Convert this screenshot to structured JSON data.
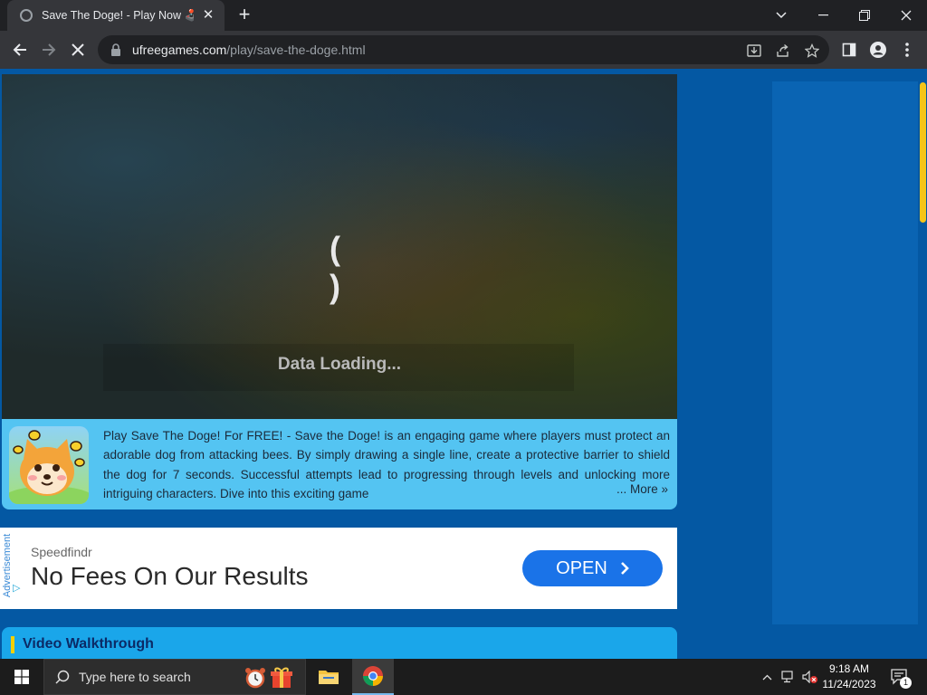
{
  "browser": {
    "tab": {
      "title": "Save The Doge! - Play Now 🕹️ O",
      "close_glyph": "✕"
    },
    "new_tab_glyph": "+",
    "url": {
      "host": "ufreegames.com",
      "path": "/play/save-the-doge.html"
    },
    "icons": {
      "back": "arrow-left-icon",
      "forward": "arrow-right-icon",
      "stop": "close-icon",
      "lock": "lock-icon",
      "install": "install-icon",
      "share": "share-icon",
      "bookmark": "star-icon",
      "side_panel": "side-panel-icon",
      "profile": "profile-icon",
      "menu": "kebab-menu-icon"
    }
  },
  "game": {
    "loading_text": "Data Loading...",
    "spinner": "( )"
  },
  "description": {
    "text": "Play Save The Doge! For FREE! - Save the Doge! is an engaging game where players must protect an adorable dog from attacking bees. By simply drawing a single line, create a protective barrier to shield the dog for 7 seconds. Successful attempts lead to progressing through levels and unlocking more intriguing characters. Dive into this exciting game",
    "more_label": "... More »"
  },
  "ad": {
    "side_label": "Advertisement",
    "source": "Speedfindr",
    "headline": "No Fees On Our Results",
    "cta_label": "OPEN",
    "cta_glyph": "›"
  },
  "sections": {
    "video_walkthrough": "Video Walkthrough"
  },
  "taskbar": {
    "search_placeholder": "Type here to search",
    "time": "9:18 AM",
    "date": "11/24/2023",
    "notification_count": "1"
  },
  "colors": {
    "page_bg": "#0458a3",
    "description_bg": "#54c4f2",
    "cta": "#1a73e8",
    "accent_yellow": "#f5c518"
  }
}
